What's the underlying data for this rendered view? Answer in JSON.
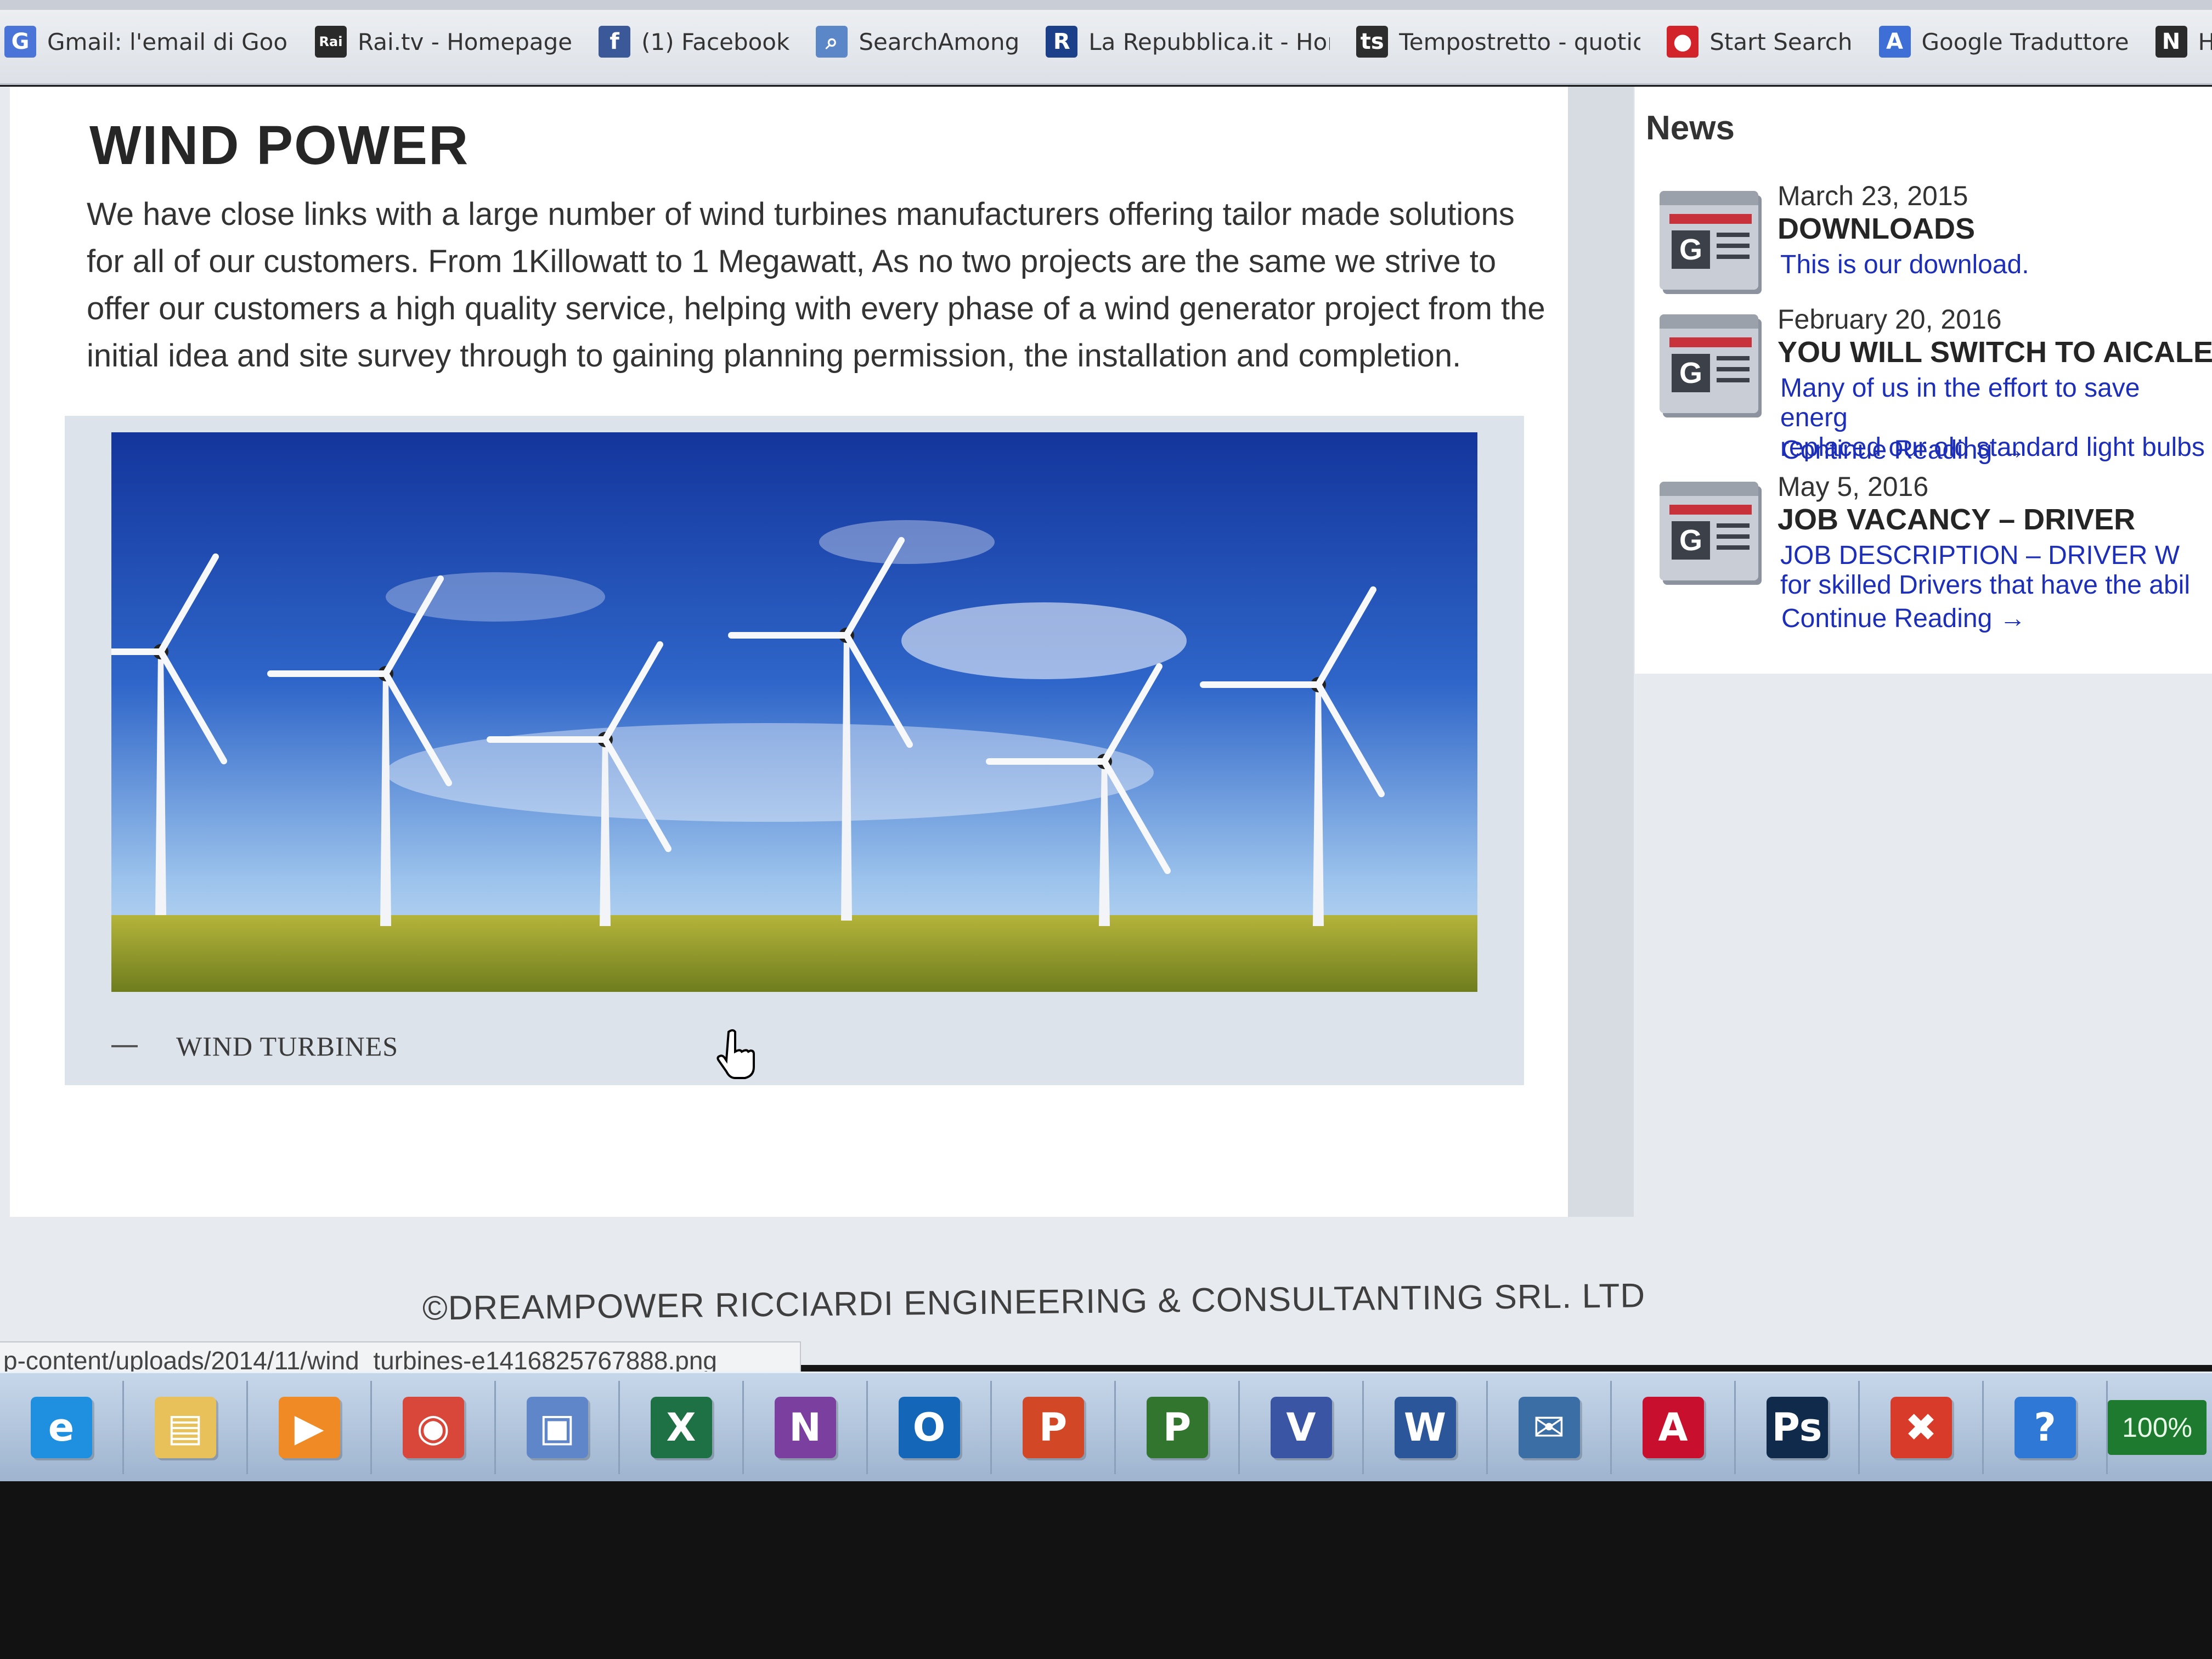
{
  "bookmarks": [
    {
      "label": "Gmail: l'email di Goog",
      "icon": "google-g-icon",
      "glyph": "G",
      "color": "#4a74d8"
    },
    {
      "label": "Rai.tv - Homepage",
      "icon": "rai-icon",
      "glyph": "Rai",
      "color": "#2a2a2a"
    },
    {
      "label": "(1) Facebook",
      "icon": "facebook-icon",
      "glyph": "f",
      "color": "#3b5998"
    },
    {
      "label": "SearchAmong",
      "icon": "magnifier-icon",
      "glyph": "⌕",
      "color": "#5b87c8"
    },
    {
      "label": "La Repubblica.it - Hon",
      "icon": "repubblica-icon",
      "glyph": "R",
      "color": "#1c3f8a"
    },
    {
      "label": "Tempostretto - quotic",
      "icon": "tempostretto-icon",
      "glyph": "ts",
      "color": "#2d2d2d"
    },
    {
      "label": "Start Search",
      "icon": "speech-bubble-icon",
      "glyph": "●",
      "color": "#d2232a"
    },
    {
      "label": "Google Traduttore",
      "icon": "translate-icon",
      "glyph": "A",
      "color": "#3d6fd6"
    },
    {
      "label": "Home",
      "icon": "home-n-icon",
      "glyph": "N",
      "color": "#2b2b2b"
    }
  ],
  "main": {
    "title": "WIND POWER",
    "intro": "We have close links with a large number of wind turbines manufacturers offering tailor made solutions for all of our customers. From 1Killowatt to 1 Megawatt, As no two projects are the same we strive to offer our customers a high quality service, helping with every phase of a wind generator project from the initial idea and site survey through to gaining planning permission, the installation and completion.",
    "figure_caption": "WIND TURBINES"
  },
  "sidebar": {
    "heading": "News",
    "items": [
      {
        "date": "March 23, 2015",
        "title": "DOWNLOADS",
        "excerpt": "This is our download.",
        "more": ""
      },
      {
        "date": "February 20, 2016",
        "title": "YOU WILL SWITCH TO AICALE",
        "excerpt": "Many of us in the effort to save energ\nreplaced our old standard light bulbs",
        "more": "Continue Reading →"
      },
      {
        "date": "May 5, 2016",
        "title": "JOB VACANCY – DRIVER",
        "excerpt": "JOB DESCRIPTION – DRIVER   W\nfor skilled Drivers that have the abil",
        "more": "Continue Reading →"
      }
    ]
  },
  "footer": {
    "text": "©DREAMPOWER RICCIARDI ENGINEERING & CONSULTANTING SRL. LTD"
  },
  "status": {
    "url": "p-content/uploads/2014/11/wind_turbines-e1416825767888.png"
  },
  "taskbar": {
    "apps": [
      {
        "name": "internet-explorer-icon",
        "glyph": "e",
        "color": "#1f8fe0"
      },
      {
        "name": "file-explorer-icon",
        "glyph": "▤",
        "color": "#e8c15a"
      },
      {
        "name": "media-player-icon",
        "glyph": "▶",
        "color": "#f08a24"
      },
      {
        "name": "chrome-icon",
        "glyph": "◉",
        "color": "#d8473a"
      },
      {
        "name": "calendar-app-icon",
        "glyph": "▣",
        "color": "#5f86c9"
      },
      {
        "name": "excel-icon",
        "glyph": "X",
        "color": "#1e7145"
      },
      {
        "name": "onenote-icon",
        "glyph": "N",
        "color": "#7b3fa0"
      },
      {
        "name": "outlook-icon",
        "glyph": "O",
        "color": "#1466b8"
      },
      {
        "name": "powerpoint-icon",
        "glyph": "P",
        "color": "#d24726"
      },
      {
        "name": "project-icon",
        "glyph": "P",
        "color": "#31752f"
      },
      {
        "name": "visio-icon",
        "glyph": "V",
        "color": "#3955a3"
      },
      {
        "name": "word-icon",
        "glyph": "W",
        "color": "#2b579a"
      },
      {
        "name": "thunderbird-icon",
        "glyph": "✉",
        "color": "#3a6ea5"
      },
      {
        "name": "acrobat-icon",
        "glyph": "A",
        "color": "#c8102e"
      },
      {
        "name": "photoshop-icon",
        "glyph": "Ps",
        "color": "#0f2a4a"
      },
      {
        "name": "office-tools-icon",
        "glyph": "✖",
        "color": "#d83b2a"
      },
      {
        "name": "help-icon",
        "glyph": "?",
        "color": "#2f78d6"
      }
    ],
    "zoom": "100%"
  }
}
